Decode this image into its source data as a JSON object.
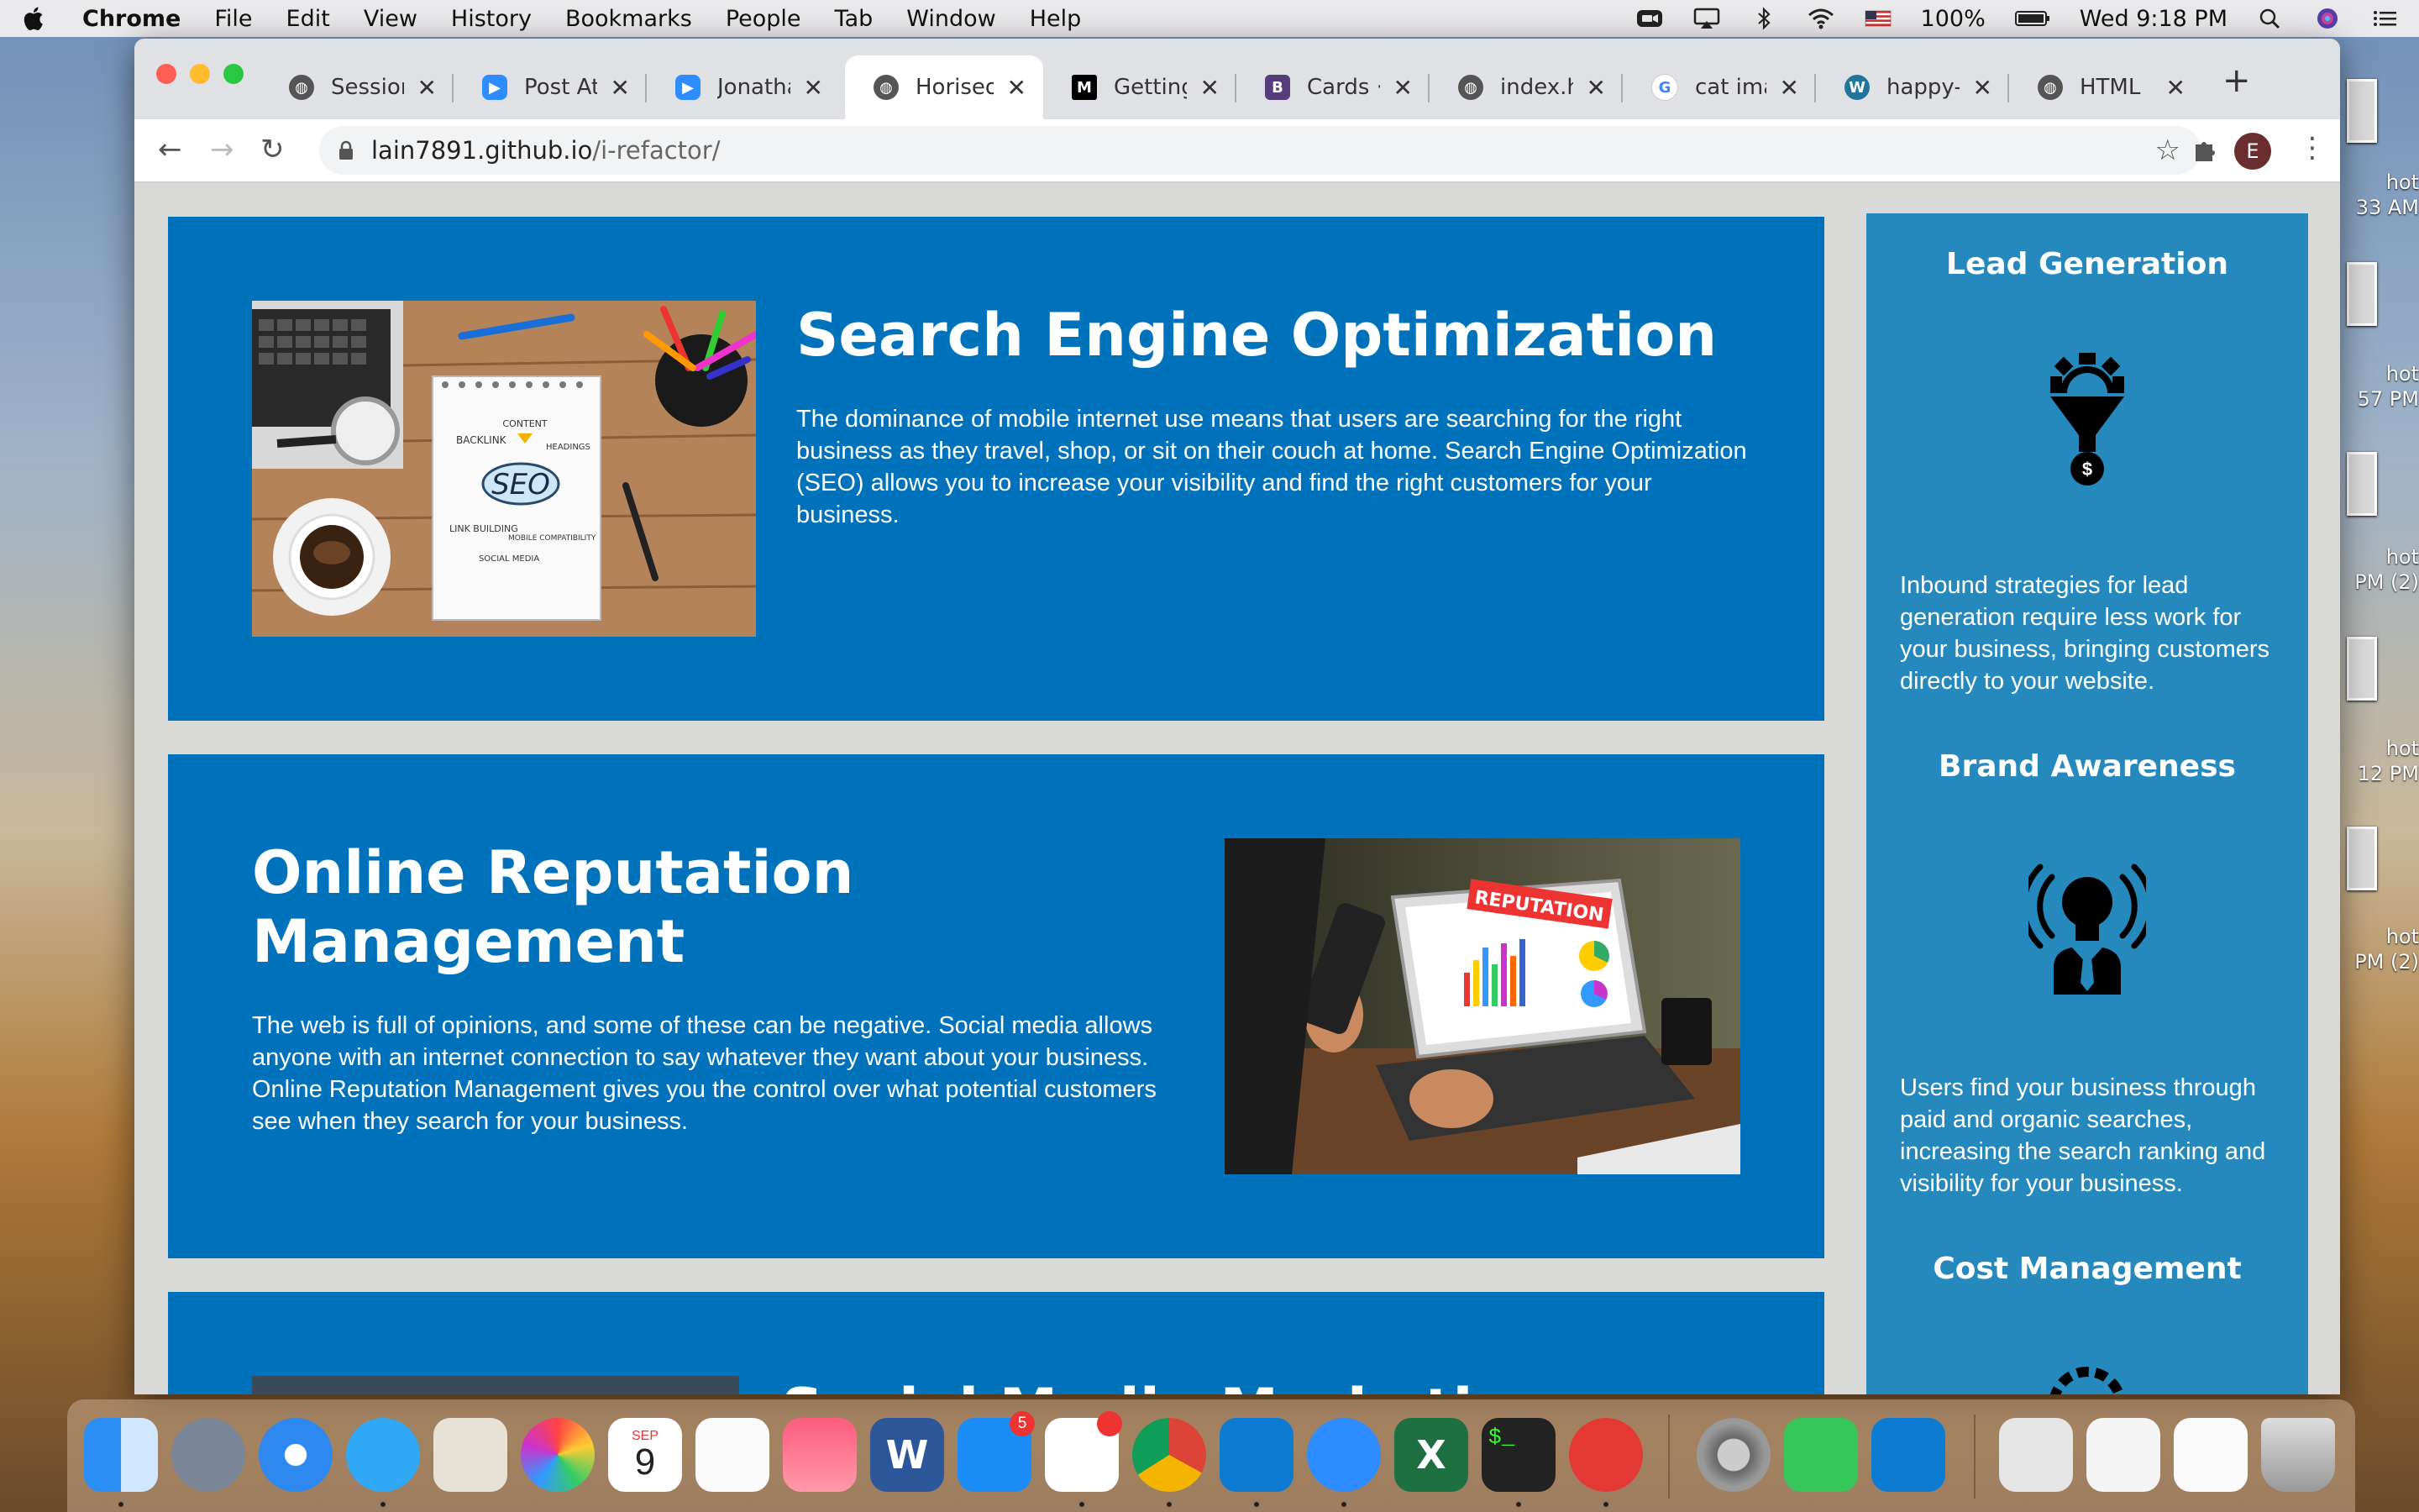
{
  "menubar": {
    "app": "Chrome",
    "items": [
      "File",
      "Edit",
      "View",
      "History",
      "Bookmarks",
      "People",
      "Tab",
      "Window",
      "Help"
    ],
    "battery": "100%",
    "clock": "Wed 9:18 PM"
  },
  "desktop": {
    "labels": [
      "hot\n33 AM",
      "hot\n57 PM",
      "hot\nPM (2)",
      "hot\n12 PM",
      "hot\nPM (2)"
    ]
  },
  "tabs": [
    {
      "title": "Session",
      "icon": "globe-icon"
    },
    {
      "title": "Post Atte",
      "icon": "zoom-icon"
    },
    {
      "title": "Jonathan",
      "icon": "zoom-icon"
    },
    {
      "title": "Horiseon",
      "icon": "globe-icon",
      "active": true
    },
    {
      "title": "Getting I",
      "icon": "medium-icon"
    },
    {
      "title": "Cards · B",
      "icon": "bootstrap-icon"
    },
    {
      "title": "index.htn",
      "icon": "globe-icon"
    },
    {
      "title": "cat image",
      "icon": "google-icon"
    },
    {
      "title": "happy-ca",
      "icon": "wordpress-icon"
    },
    {
      "title": "HTML",
      "icon": "globe-icon"
    }
  ],
  "toolbar": {
    "url_host": "lain7891.github.io",
    "url_path": "/i-refactor/",
    "profile_initial": "E"
  },
  "content": {
    "seo": {
      "title": "Search Engine Optimization",
      "body": "The dominance of mobile internet use means that users are searching for the right business as they travel, shop, or sit on their couch at home. Search Engine Optimization (SEO) allows you to increase your visibility and find the right customers for your business."
    },
    "orm": {
      "title": "Online Reputation Management",
      "body": "The web is full of opinions, and some of these can be negative. Social media allows anyone with an internet connection to say whatever they want about your business. Online Reputation Management gives you the control over what potential customers see when they search for your business."
    },
    "smm": {
      "title": "Social Media Marketing"
    }
  },
  "seo_image_words": {
    "seo": "SEO",
    "content": "CONTENT",
    "backlink": "BACKLINK",
    "headings": "HEADINGS",
    "link_building": "LINK BUILDING",
    "mobile": "MOBILE COMPATIBILITY",
    "social": "SOCIAL MEDIA"
  },
  "orm_image_words": {
    "reputation": "REPUTATION"
  },
  "sidebar": {
    "lead": {
      "title": "Lead Generation",
      "body": "Inbound strategies for lead generation require less work for your business, bringing customers directly to your website.",
      "icon_symbol": "$"
    },
    "brand": {
      "title": "Brand Awareness",
      "body": "Users find your business through paid and organic searches, increasing the search ranking and visibility for your business."
    },
    "cost": {
      "title": "Cost Management"
    }
  },
  "dock": {
    "calendar_month": "SEP",
    "calendar_day": "9",
    "appstore_badge": "5"
  },
  "colors": {
    "card_blue": "#0072bb",
    "sidebar_blue": "#2589bd",
    "page_bg": "#d9dad8"
  }
}
